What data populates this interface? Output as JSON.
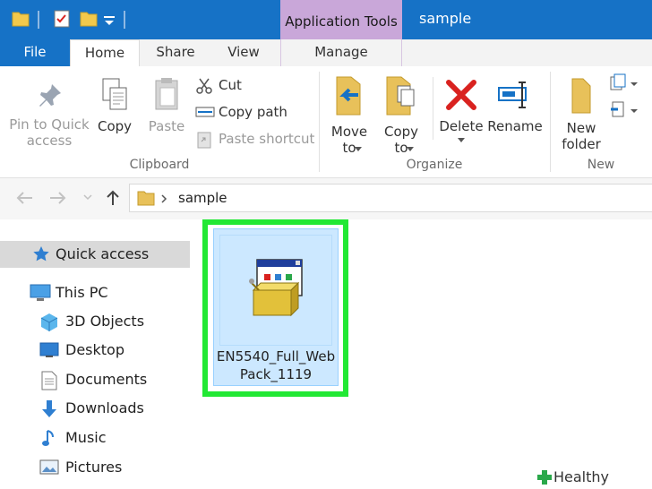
{
  "titlebar": {
    "context_tab": "Application Tools",
    "window_title": "sample"
  },
  "tabs": {
    "file": "File",
    "home": "Home",
    "share": "Share",
    "view": "View",
    "manage": "Manage"
  },
  "ribbon": {
    "clipboard": {
      "group_label": "Clipboard",
      "pin_line1": "Pin to Quick",
      "pin_line2": "access",
      "copy": "Copy",
      "paste": "Paste",
      "cut": "Cut",
      "copy_path": "Copy path",
      "paste_shortcut": "Paste shortcut"
    },
    "organize": {
      "group_label": "Organize",
      "move_line1": "Move",
      "move_line2": "to",
      "copy_line1": "Copy",
      "copy_line2": "to",
      "delete": "Delete",
      "rename": "Rename"
    },
    "new": {
      "group_label": "New",
      "folder_line1": "New",
      "folder_line2": "folder"
    }
  },
  "address": {
    "path": "sample"
  },
  "nav": {
    "items": [
      {
        "label": "Quick access"
      },
      {
        "label": "This PC"
      },
      {
        "label": "3D Objects"
      },
      {
        "label": "Desktop"
      },
      {
        "label": "Documents"
      },
      {
        "label": "Downloads"
      },
      {
        "label": "Music"
      },
      {
        "label": "Pictures"
      }
    ]
  },
  "files": [
    {
      "name": "EN5540_Full_WebPack_1119"
    }
  ],
  "watermark": {
    "text": "Healthy Living"
  },
  "colors": {
    "titlebar": "#1672c6",
    "context_tab": "#c9a7d9",
    "selection": "#cce8ff",
    "highlight": "#22e834",
    "delete_red": "#d9221f"
  }
}
